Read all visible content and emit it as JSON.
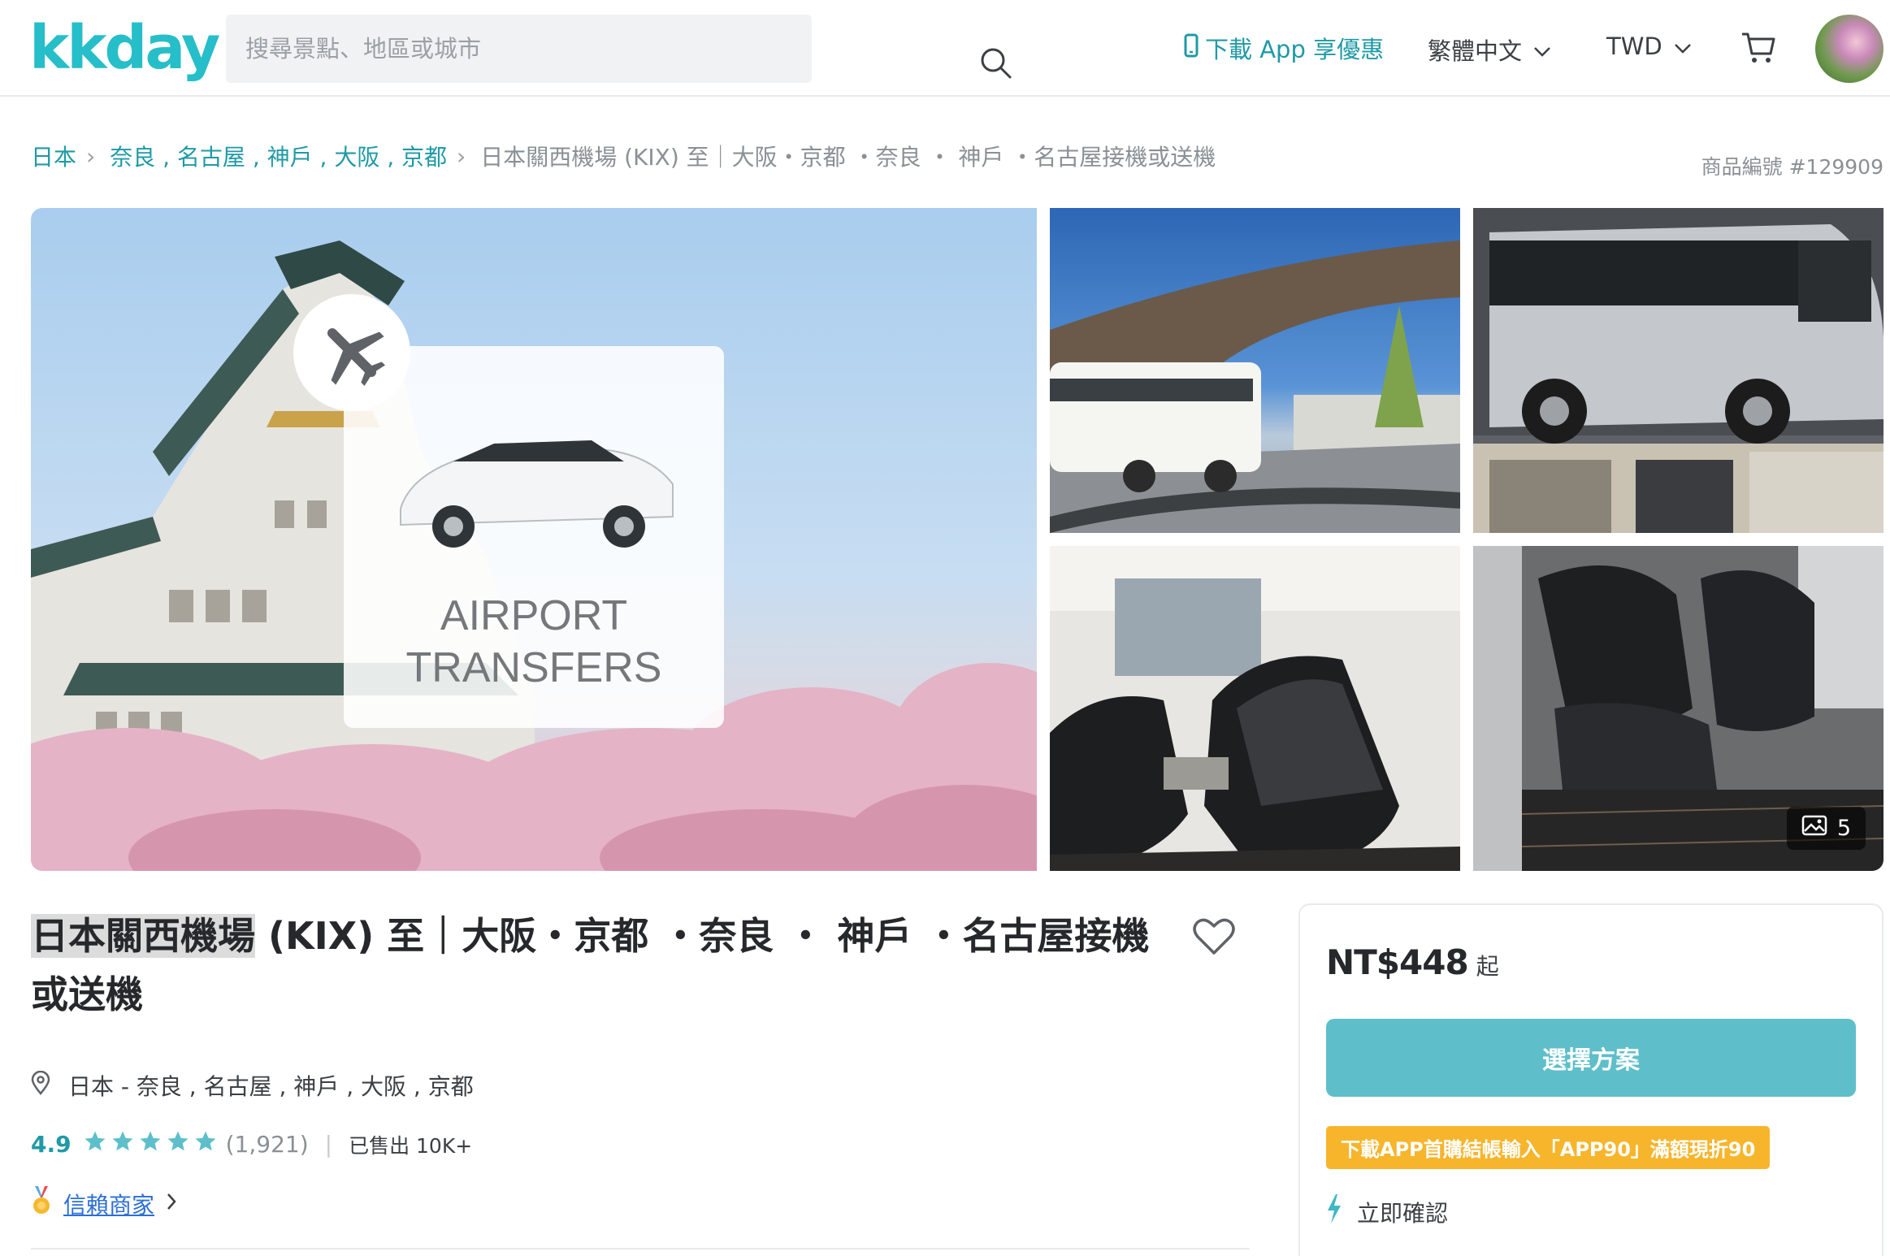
{
  "header": {
    "logo": "kkday",
    "search_placeholder": "搜尋景點、地區或城市",
    "app_link": "下載 App 享優惠",
    "language": "繁體中文",
    "currency": "TWD"
  },
  "breadcrumb": {
    "items": [
      "日本",
      "奈良 , 名古屋 , 神戶 , 大阪 , 京都"
    ],
    "current": "日本關西機場 (KIX) 至｜大阪・京都 ・奈良 ・ 神戶 ・名古屋接機或送機",
    "product_id": "商品編號 #129909"
  },
  "gallery": {
    "main_caption_line1": "AIRPORT",
    "main_caption_line2": "TRANSFERS",
    "more_photos_count": "5"
  },
  "product": {
    "title_highlight": "日本關西機場",
    "title_rest": " (KIX) 至｜大阪・京都 ・奈良 ・ 神戶 ・名古屋接機或送機",
    "location": "日本 - 奈良 , 名古屋 , 神戶 , 大阪 , 京都",
    "rating": "4.9",
    "star_count": 5,
    "reviews": "(1,921)",
    "sold": "已售出 10K+",
    "trusted_label": "信賴商家"
  },
  "booking": {
    "price": "NT$448",
    "price_suffix": "起",
    "select_button": "選擇方案",
    "promo": "下載APP首購結帳輸入「APP90」滿額現折90",
    "instant_confirm": "立即確認"
  },
  "colors": {
    "brand": "#26bec9",
    "link": "#1f9aa6",
    "button": "#5ebfca",
    "promo": "#f7b52c",
    "star": "#5ebfca"
  }
}
